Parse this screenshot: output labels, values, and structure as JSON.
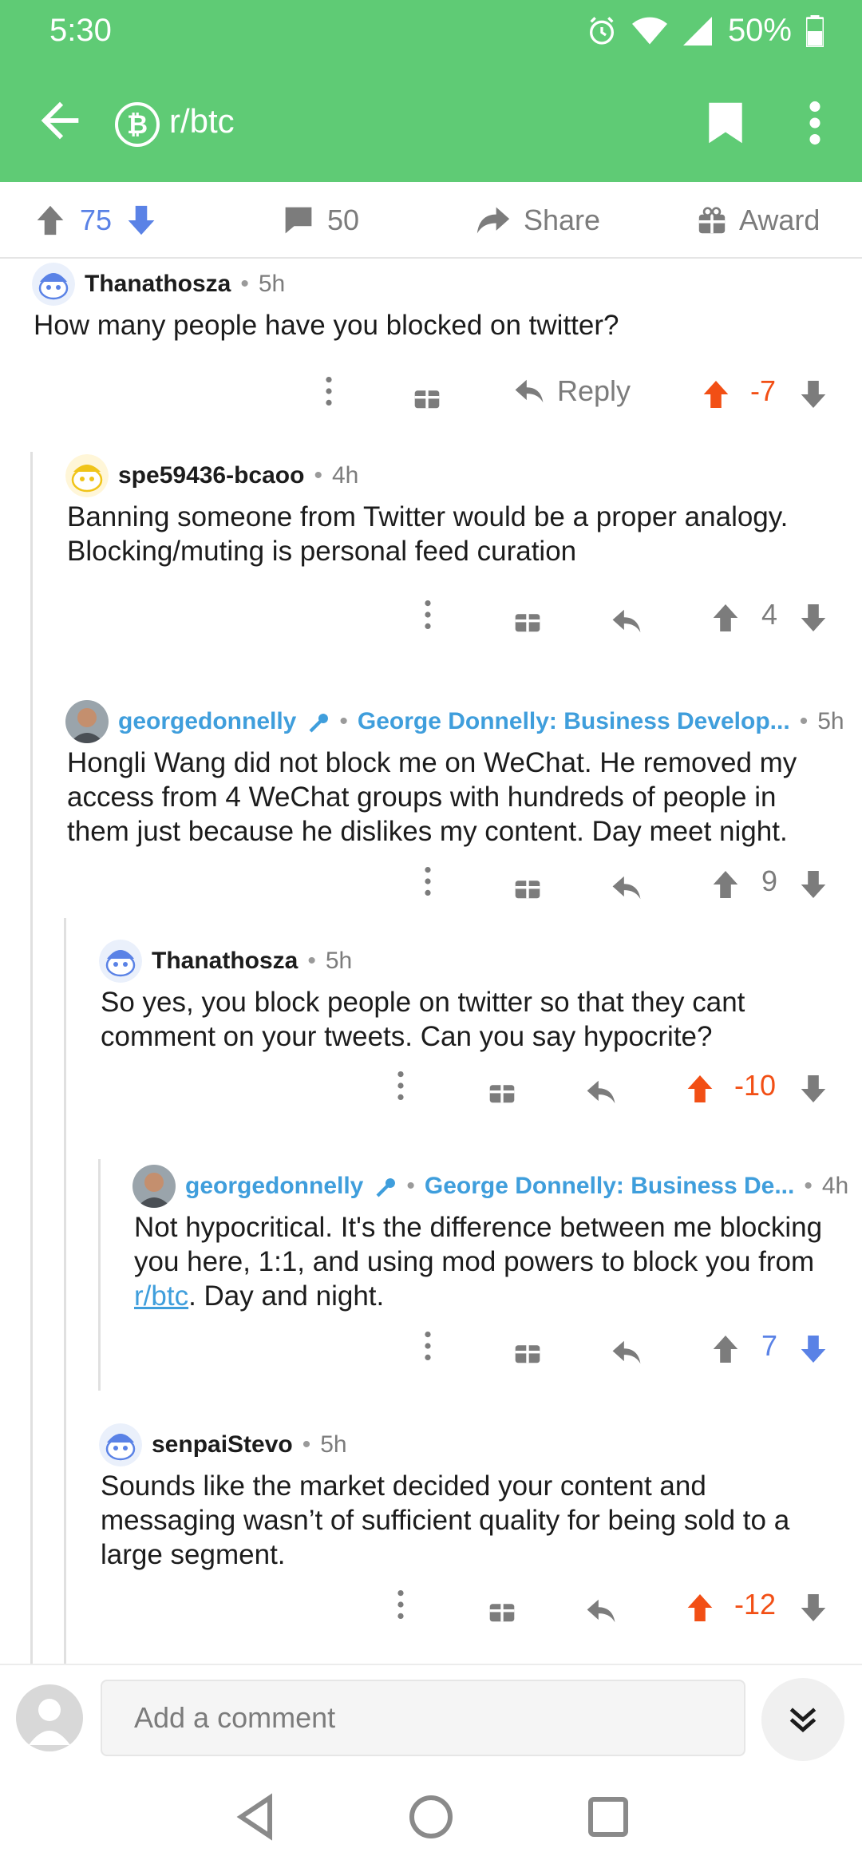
{
  "status_bar": {
    "time": "5:30",
    "battery": "50%"
  },
  "header": {
    "subreddit": "r/btc",
    "sub_icon": "bitcoin-icon"
  },
  "post_bar": {
    "upvotes": "75",
    "comments": "50",
    "share": "Share",
    "award": "Award"
  },
  "comments": [
    {
      "author": "Thanathosza",
      "age": "5h",
      "flair": "",
      "body": "How many people have you blocked on twitter?",
      "score": "-7",
      "reply": "Reply"
    },
    {
      "author": "spe59436-bcaoo",
      "age": "4h",
      "flair": "",
      "body": "Banning someone from Twitter would be a proper analogy. Blocking/muting is personal feed curation",
      "score": "4"
    },
    {
      "author": "georgedonnelly",
      "age": "5h",
      "flair": "George Donnelly: Business Develop...",
      "body": "Hongli Wang did not block me on WeChat. He removed my access from 4 WeChat groups with hundreds of people in them just because he dislikes my content. Day meet night.",
      "score": "9"
    },
    {
      "author": "Thanathosza",
      "age": "5h",
      "flair": "",
      "body": "So yes, you block people on twitter so that they cant comment on your tweets. Can you say hypocrite?",
      "score": "-10"
    },
    {
      "author": "georgedonnelly",
      "age": "4h",
      "flair": "George Donnelly: Business De...",
      "body_before": "Not hypocritical. It's the difference between me blocking you here, 1:1, and using mod powers to block you from ",
      "body_link": "r/btc",
      "body_after": ". Day and night.",
      "score": "7"
    },
    {
      "author": "senpaiStevo",
      "age": "5h",
      "flair": "",
      "body": "Sounds like the market decided your content and messaging wasn’t of sufficient quality for being sold to a large segment.",
      "score": "-12"
    }
  ],
  "composer": {
    "placeholder": "Add a comment"
  },
  "separator": "•",
  "colors": {
    "header": "#5fcb75",
    "op_blue": "#3f9edc",
    "upvote_orange": "#f24f15",
    "downvote_blue": "#5a82e6"
  }
}
